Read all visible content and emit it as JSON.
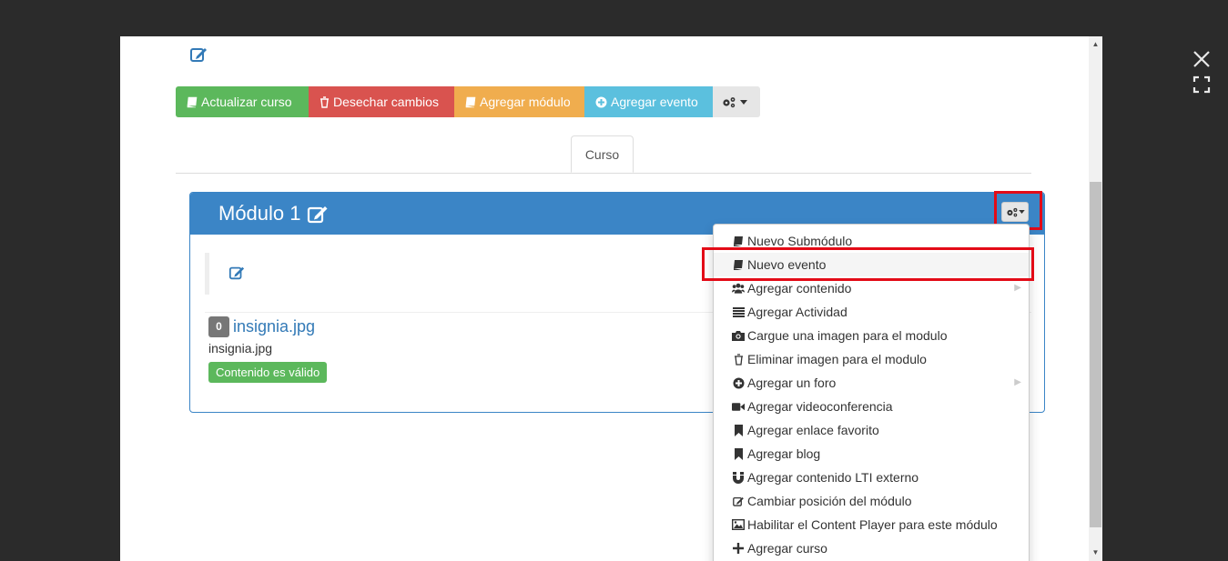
{
  "toolbar": {
    "update_course": "Actualizar curso",
    "discard_changes": "Desechar cambios",
    "add_module": "Agregar módulo",
    "add_event": "Agregar evento"
  },
  "tabs": [
    {
      "label": "Curso"
    }
  ],
  "module": {
    "title": "Módulo 1",
    "item": {
      "count": "0",
      "link": "insignia.jpg",
      "filename": "insignia.jpg",
      "status": "Contenido es válido"
    }
  },
  "menu": {
    "items": [
      {
        "label": "Nuevo Submódulo",
        "icon": "book-icon"
      },
      {
        "label": "Nuevo evento",
        "icon": "book-icon"
      },
      {
        "label": "Agregar contenido",
        "icon": "users-icon"
      },
      {
        "label": "Agregar Actividad",
        "icon": "list-icon"
      },
      {
        "label": "Cargue una imagen para el modulo",
        "icon": "camera-icon"
      },
      {
        "label": "Eliminar imagen para el modulo",
        "icon": "trash-icon"
      },
      {
        "label": "Agregar un foro",
        "icon": "plus-circle-icon"
      },
      {
        "label": "Agregar videoconferencia",
        "icon": "video-icon"
      },
      {
        "label": "Agregar enlace favorito",
        "icon": "bookmark-icon"
      },
      {
        "label": "Agregar blog",
        "icon": "bookmark-icon"
      },
      {
        "label": "Agregar contenido LTI externo",
        "icon": "magnet-icon"
      },
      {
        "label": "Cambiar posición del módulo",
        "icon": "edit-icon"
      },
      {
        "label": "Habilitar el Content Player para este módulo",
        "icon": "image-icon"
      },
      {
        "label": "Agregar curso",
        "icon": "plus-icon"
      }
    ]
  },
  "colors": {
    "primary": "#3b85c6",
    "success": "#5cb85c",
    "danger": "#d9534f",
    "warning": "#f0ad4e",
    "info": "#5bc0de",
    "highlight": "#e30b17"
  }
}
